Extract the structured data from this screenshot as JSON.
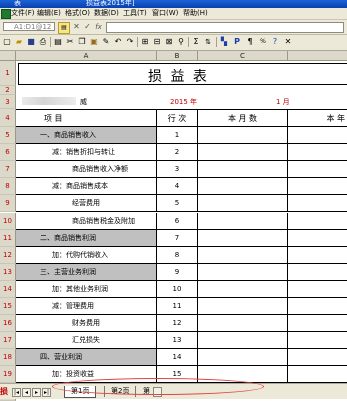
{
  "window": {
    "app_icon": "excel-icon",
    "title_left": "表",
    "title_file": "损益表2015年]"
  },
  "menu": {
    "items": [
      "文件(F)",
      "编辑(E)",
      "格式(O)",
      "数据(D)",
      "工具(T)",
      "窗口(W)",
      "帮助(H)"
    ]
  },
  "formula_bar": {
    "name_box": "A1:D1@12",
    "cancel": "✕",
    "confirm": "✓",
    "function": "fx",
    "content": ""
  },
  "toolbar": {
    "icons": [
      "new-icon",
      "open-icon",
      "save-icon",
      "print-preview-icon",
      "print-icon",
      "cut-icon",
      "copy-icon",
      "paste-icon",
      "format-painter-icon",
      "undo-icon",
      "redo-icon",
      "insert-row-icon",
      "insert-col-icon",
      "delete-icon",
      "find-icon",
      "sum-icon",
      "sort-icon",
      "chart-icon",
      "pivot-icon",
      "function-icon",
      "help-icon",
      "close-icon"
    ]
  },
  "sheet": {
    "columns": [
      "A",
      "B",
      "C",
      ""
    ],
    "rows": [
      "1",
      "2",
      "3",
      "4",
      "5",
      "6",
      "7",
      "8",
      "9",
      "10",
      "11",
      "12",
      "13",
      "14",
      "15",
      "16",
      "17",
      "18",
      "19",
      "20"
    ],
    "title": "损   益   表",
    "row3": {
      "company": "威",
      "year": "2015 年",
      "month": "1  月"
    },
    "header": {
      "item": "项          目",
      "line": "行  次",
      "current": "本  月  数",
      "ytd": "本  年"
    },
    "lines": [
      {
        "label": "一、商品销售收入",
        "no": "1",
        "indent": 1,
        "gray": true
      },
      {
        "label": "减：销售折扣与转让",
        "no": "2",
        "indent": 2,
        "gray": false
      },
      {
        "label": "商品销售收入净额",
        "no": "3",
        "indent": 3,
        "gray": false
      },
      {
        "label": "减：商品销售成本",
        "no": "4",
        "indent": 2,
        "gray": false
      },
      {
        "label": "经营费用",
        "no": "5",
        "indent": 3,
        "gray": false
      },
      {
        "label": "商品销售税金及附加",
        "no": "6",
        "indent": 3,
        "gray": false
      },
      {
        "label": "二、商品销售利润",
        "no": "7",
        "indent": 1,
        "gray": true
      },
      {
        "label": "加：代购代销收入",
        "no": "8",
        "indent": 2,
        "gray": false
      },
      {
        "label": "三、主营业务利润",
        "no": "9",
        "indent": 1,
        "gray": true
      },
      {
        "label": "加：其他业务利润",
        "no": "10",
        "indent": 2,
        "gray": false
      },
      {
        "label": "减：管理费用",
        "no": "11",
        "indent": 2,
        "gray": false
      },
      {
        "label": "财务费用",
        "no": "12",
        "indent": 3,
        "gray": false
      },
      {
        "label": "汇兑损失",
        "no": "13",
        "indent": 3,
        "gray": false
      },
      {
        "label": "四、营业利润",
        "no": "14",
        "indent": 1,
        "gray": true
      },
      {
        "label": "加：投资收益",
        "no": "15",
        "indent": 2,
        "gray": false
      }
    ]
  },
  "tabs": {
    "nav": [
      "|◂",
      "◂",
      "▸",
      "▸|"
    ],
    "left_red_text": "损",
    "sheets": [
      "第1页",
      "第2页",
      "第"
    ]
  },
  "colors": {
    "title_bar": "#0a3fae",
    "chrome": "#ece9d8",
    "header_gray": "#c0c0c0",
    "row_header_text": "#c00000",
    "year_text": "#c00000",
    "highlight_ellipse": "#e04646"
  }
}
